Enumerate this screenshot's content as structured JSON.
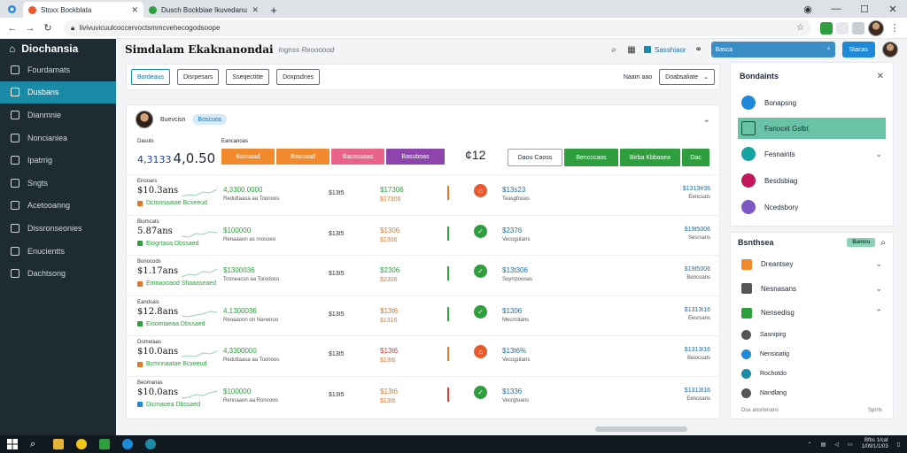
{
  "browser": {
    "tabs": [
      {
        "label": "Stoxx Bockblata",
        "active": true
      },
      {
        "label": "Dusch Bockbiae Ikuvedanue I Ivoyoa",
        "active": false
      }
    ],
    "new_tab": "+",
    "url": "Iivivuvicuulcoccervoctsmmcvehecogodsoope"
  },
  "sidebar": {
    "brand": "Diochansia",
    "items": [
      {
        "label": "Fourdamats",
        "active": false
      },
      {
        "label": "Dusbans",
        "active": true
      },
      {
        "label": "Dianmnie",
        "active": false
      },
      {
        "label": "Noncianiea",
        "active": false
      },
      {
        "label": "Ipatrrig",
        "active": false
      },
      {
        "label": "Sngts",
        "active": false
      },
      {
        "label": "Acetooanng",
        "active": false
      },
      {
        "label": "Dissronseonies",
        "active": false
      },
      {
        "label": "Enucientts",
        "active": false
      },
      {
        "label": "Dachtsong",
        "active": false
      }
    ]
  },
  "header": {
    "title": "Simdalam Ekaknanondai",
    "subtitle": "Ingnss Reoooood",
    "shared_label": "Sasshiaor",
    "search_placeholder": "Basca",
    "action_label": "Stacas"
  },
  "filters": {
    "buttons": [
      "Bordeaus",
      "Disrpesars",
      "Sseqectitte",
      "Doxpsdnes"
    ],
    "right_label": "Naam aao",
    "sort_label": "Doabsaliate"
  },
  "card": {
    "name": "Buevcisn",
    "chip": "Boscuos",
    "summary_label": "Dasuts",
    "summary_label2": "Eancanoas",
    "big_prefix": "4,3133",
    "big_value": "4,0.50",
    "mid_value": "¢12",
    "pills": [
      {
        "label": "Bassaad",
        "color": "#f08a2c"
      },
      {
        "label": "Baasaad",
        "color": "#f08a2c"
      },
      {
        "label": "Bacasaaas",
        "color": "#e8648a"
      },
      {
        "label": "Basuboas",
        "color": "#8e44ad"
      }
    ],
    "outline_btn": "Daou Caoss",
    "green_btns": [
      "Bencccaos",
      "Birba Kbbasea",
      "Dac"
    ]
  },
  "rows": [
    {
      "label": "Enooars",
      "price": "$10.3ans",
      "tag": "Dcmnnaatae Bcxeeud",
      "tag_color": "orange",
      "g1": "4,3300.0000",
      "g2": "Reduttaasa aa Toonoos",
      "mid": "$13t5",
      "c1": "$17306",
      "c1_color": "green",
      "c2": "$17306",
      "bar": "#e0782a",
      "circle": "#e85a2c",
      "circle_glyph": "⌂",
      "d1": "$13s23",
      "d2": "Teasgfooas",
      "e1": "$1313#36",
      "e2": "Eencsats"
    },
    {
      "label": "Biomcats",
      "price": "5.87ans",
      "tag": "Eiogrtaoa Dbssaed",
      "tag_color": "green",
      "g1": "$100000",
      "g2": "Renaaaon as rnosoeo",
      "mid": "$13t5",
      "c1": "$1306",
      "c1_color": "orange",
      "c2": "$1306",
      "bar": "#2e9e3e",
      "circle": "#2e9e3e",
      "circle_glyph": "✓",
      "d1": "$2376",
      "d2": "Vecogutans",
      "e1": "$19t5006",
      "e2": "Sesrsans"
    },
    {
      "label": "Bonocods",
      "price": "$1.17ans",
      "tag": "Emnaooaod Shaaaseaed",
      "tag_color": "orange",
      "g1": "$1300036",
      "g2": "Tconeacsn aa Torodoco",
      "mid": "$13t5",
      "c1": "$2306",
      "c1_color": "green",
      "c2": "$2306",
      "bar": "#2e9e3e",
      "circle": "#2e9e3e",
      "circle_glyph": "✓",
      "d1": "$13t306",
      "d2": "Soyrrpoooas",
      "e1": "$19t5006",
      "e2": "Bencoans"
    },
    {
      "label": "Eandsais",
      "price": "$12.8ans",
      "tag": "Eisomtaeaa Dbssaed",
      "tag_color": "green",
      "g1": "4,1300036",
      "g2": "Reoaaoon on Nanenoo",
      "mid": "$13t5",
      "c1": "$13t6",
      "c1_color": "orange",
      "c2": "$1316",
      "bar": "#2e9e3e",
      "circle": "#2e9e3e",
      "circle_glyph": "✓",
      "d1": "$1306",
      "d2": "Mecrrotans",
      "e1": "$1313t16",
      "e2": "Eesrsans"
    },
    {
      "label": "Domeiaas",
      "price": "$10.0ans",
      "tag": "Bcmnnaatae Bcxeeud",
      "tag_color": "orange",
      "g1": "4,3300000",
      "g2": "Reduttaasa aa Toonoos",
      "mid": "$13t5",
      "c1": "$13t6",
      "c1_color": "red",
      "c2": "$13t6",
      "bar": "#e0782a",
      "circle": "#e85a2c",
      "circle_glyph": "⌂",
      "d1": "$13t6%",
      "d2": "Vecogutans",
      "e1": "$1313t16",
      "e2": "Beiocsats"
    },
    {
      "label": "Beomanas",
      "price": "$10.0ans",
      "tag": "Dicmaoea Dbssaed",
      "tag_color": "blue",
      "g1": "$100000",
      "g2": "Rennaaon aa Ronvooo",
      "mid": "$13t5",
      "c1": "$13t6",
      "c1_color": "orange",
      "c2": "$13t6",
      "bar": "#dc3b2f",
      "circle": "#2e9e3e",
      "circle_glyph": "✓",
      "d1": "$1336",
      "d2": "Vecrgtoans",
      "e1": "$1313t16",
      "e2": "Eencoans"
    }
  ],
  "panel1": {
    "title": "Bondaints",
    "items": [
      {
        "label": "Bonapsng",
        "color": "#1e88d9",
        "selected": false,
        "chevron": false
      },
      {
        "label": "Fanocet Gslbt",
        "color": "#69c4a7",
        "selected": true,
        "chevron": false
      },
      {
        "label": "Fesnaints",
        "color": "#17a2a2",
        "selected": false,
        "chevron": true
      },
      {
        "label": "Besdsbiag",
        "color": "#c2185b",
        "selected": false,
        "chevron": false
      },
      {
        "label": "Ncedsbory",
        "color": "#7e57c2",
        "selected": false,
        "chevron": false
      }
    ]
  },
  "panel2": {
    "title": "Bsnthsea",
    "tag": "Banicu",
    "items": [
      {
        "label": "Dreantsey",
        "color": "#f08a2c",
        "chevron": "⌄"
      },
      {
        "label": "Nesnasans",
        "color": "#555555",
        "chevron": "⌄"
      },
      {
        "label": "Nensedisg",
        "color": "#2e9e3e",
        "chevron": "⌃"
      }
    ],
    "subitems": [
      {
        "label": "Sasnipirg",
        "color": "#555555"
      },
      {
        "label": "Nensioatig",
        "color": "#1e88d9"
      },
      {
        "label": "Rochotdo",
        "color": "#1b8aa6"
      },
      {
        "label": "Nandlang",
        "color": "#555555"
      }
    ],
    "foot_left": "Dse ansrtenans",
    "foot_right": "Sprrts"
  },
  "taskbar": {
    "time": "Bfbs 1/cat",
    "date": "1/09/1/1/03"
  },
  "colors": {
    "sidebar_bg": "#1e2b33",
    "accent": "#1b8aa6",
    "green": "#2e9e3e",
    "orange": "#f08a2c"
  }
}
